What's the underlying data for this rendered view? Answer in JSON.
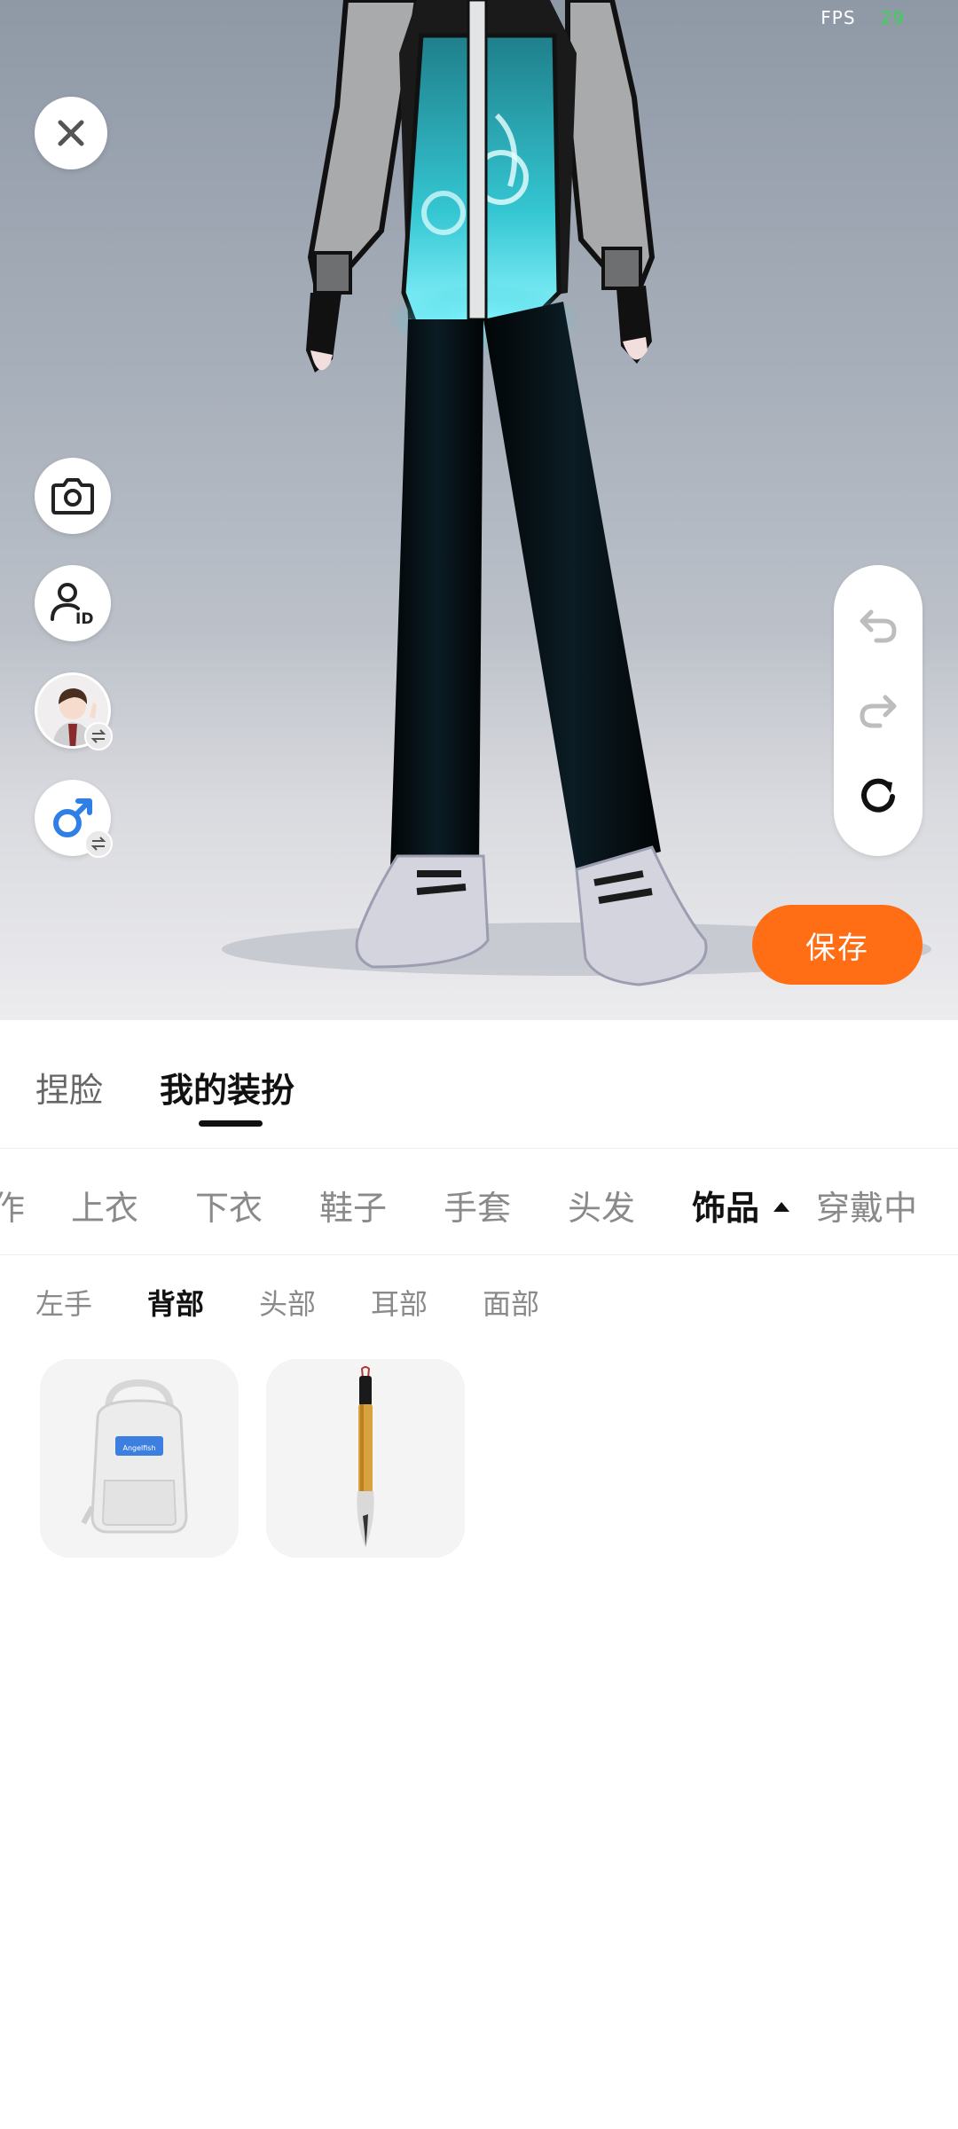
{
  "viewport": {
    "fps_label": "FPS",
    "fps_value": "29"
  },
  "buttons": {
    "save_label": "保存"
  },
  "main_tabs": [
    {
      "label": "捏脸",
      "active": false
    },
    {
      "label": "我的装扮",
      "active": true
    }
  ],
  "category_tabs": [
    {
      "label": "动作",
      "active": false
    },
    {
      "label": "上衣",
      "active": false
    },
    {
      "label": "下衣",
      "active": false
    },
    {
      "label": "鞋子",
      "active": false
    },
    {
      "label": "手套",
      "active": false
    },
    {
      "label": "头发",
      "active": false
    },
    {
      "label": "饰品",
      "active": true
    },
    {
      "label": "穿戴中",
      "active": false
    }
  ],
  "sub_tabs": [
    {
      "label": "左手",
      "active": false
    },
    {
      "label": "背部",
      "active": true
    },
    {
      "label": "头部",
      "active": false
    },
    {
      "label": "耳部",
      "active": false
    },
    {
      "label": "面部",
      "active": false
    }
  ],
  "items": [
    {
      "name": "backpack",
      "icon": "backpack-icon",
      "tag_text": "Angelfish"
    },
    {
      "name": "calligraphy-brush",
      "icon": "brush-icon"
    }
  ],
  "colors": {
    "accent": "#ff6d14",
    "fps_value": "#39d353",
    "gender_icon": "#2f7fe6",
    "shirt_glow": "#35c9d6"
  }
}
